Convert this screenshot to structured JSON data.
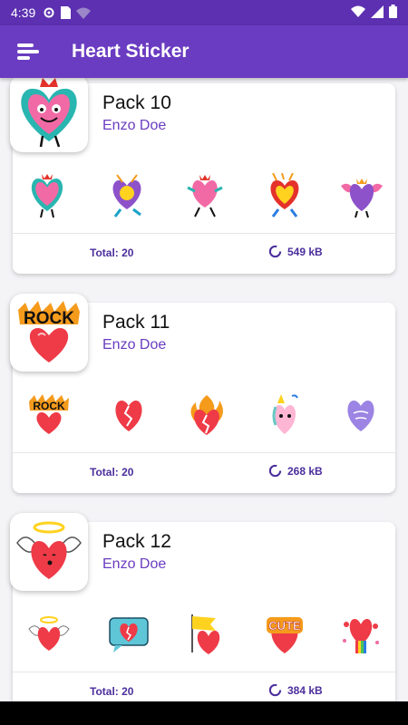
{
  "status": {
    "time": "4:39"
  },
  "app": {
    "title": "Heart Sticker",
    "accent": "#6a3cc1"
  },
  "packs": [
    {
      "name": "Pack 10",
      "author": "Enzo Doe",
      "total": "Total: 20",
      "size": "549 kB"
    },
    {
      "name": "Pack 11",
      "author": "Enzo Doe",
      "total": "Total: 20",
      "size": "268 kB"
    },
    {
      "name": "Pack 12",
      "author": "Enzo Doe",
      "total": "Total: 20",
      "size": "384 kB"
    }
  ],
  "icons": {
    "menu": "menu-icon",
    "size": "circular-progress-icon"
  }
}
